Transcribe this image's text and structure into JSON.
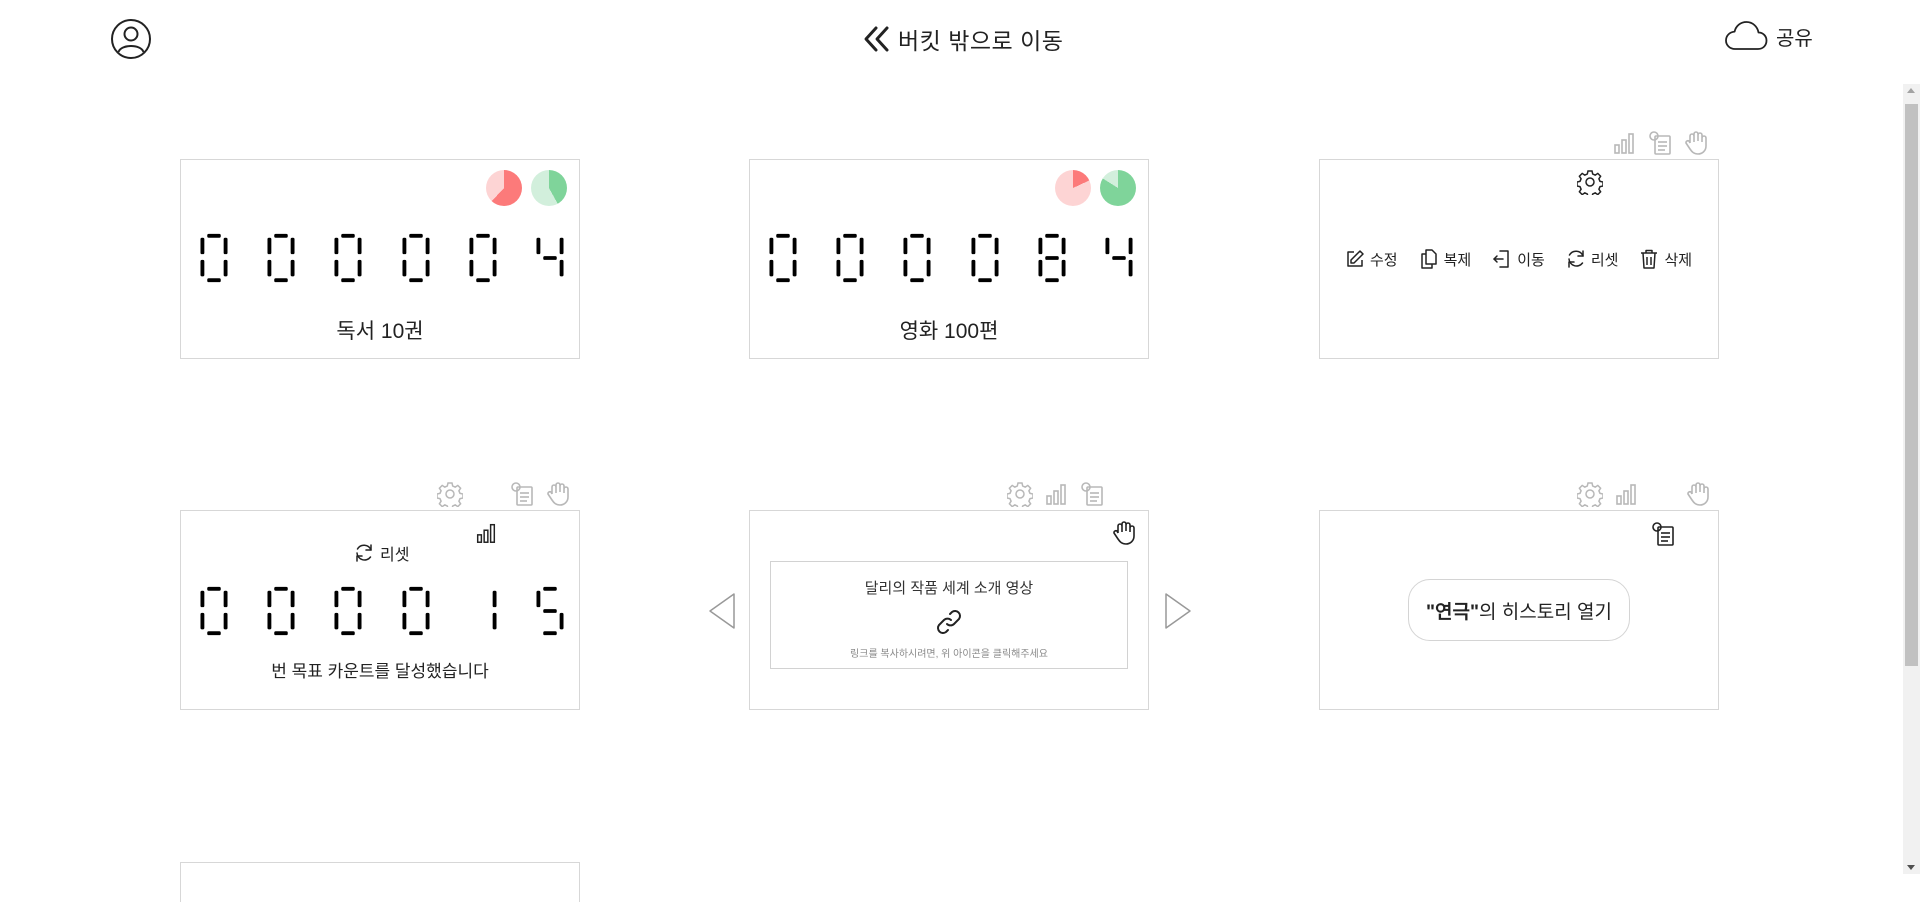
{
  "header": {
    "back_label": "버킷 밖으로 이동",
    "share_label": "공유",
    "icons": [
      "user-icon",
      "double-chevron-left-icon",
      "cloud-icon"
    ]
  },
  "cards": [
    {
      "kind": "counter",
      "digits": [
        "0",
        "0",
        "0",
        "0",
        "0",
        "4"
      ],
      "label": "독서 10권",
      "pies": [
        {
          "name": "red",
          "color": "#fc7a7a",
          "track": "#fdd4d4",
          "fraction": 0.62
        },
        {
          "name": "green",
          "color": "#7fd49a",
          "track": "#d2efdc",
          "fraction": 0.42
        }
      ]
    },
    {
      "kind": "counter",
      "digits": [
        "0",
        "0",
        "0",
        "0",
        "8",
        "4"
      ],
      "label": "영화 100편",
      "pies": [
        {
          "name": "red",
          "color": "#fc7a7a",
          "track": "#fdd4d4",
          "fraction": 0.18
        },
        {
          "name": "green",
          "color": "#7fd49a",
          "track": "#d2efdc",
          "fraction": 0.84
        }
      ]
    },
    {
      "kind": "settings",
      "tools": [
        "bar-chart-icon",
        "memo-icon",
        "hand-icon"
      ],
      "actions": [
        {
          "icon": "edit-icon",
          "label": "수정"
        },
        {
          "icon": "copy-icon",
          "label": "복제"
        },
        {
          "icon": "move-icon",
          "label": "이동"
        },
        {
          "icon": "refresh-icon",
          "label": "리셋"
        },
        {
          "icon": "trash-icon",
          "label": "삭제"
        }
      ]
    },
    {
      "kind": "counter-reset",
      "tools": [
        "gear-icon",
        "memo-icon",
        "hand-icon"
      ],
      "reset_label": "리셋",
      "digits": [
        "0",
        "0",
        "0",
        "0",
        "1",
        "5"
      ],
      "label": "번 목표 카운트를 달성했습니다"
    },
    {
      "kind": "link",
      "tools": [
        "gear-icon",
        "bar-chart-icon",
        "memo-icon"
      ],
      "link_title": "달리의 작품 세계 소개 영상",
      "link_hint": "링크를 복사하시려면, 위 아이콘을 클릭해주세요"
    },
    {
      "kind": "history",
      "tools": [
        "gear-icon",
        "bar-chart-icon",
        "hand-icon"
      ],
      "history_quote": "\"연극\"",
      "history_suffix": "의 히스토리 열기"
    }
  ],
  "colors": {
    "border": "#d7d7d7",
    "digit": "#000000",
    "icon": "#222222",
    "icon_faded": "#b8b8b8"
  }
}
